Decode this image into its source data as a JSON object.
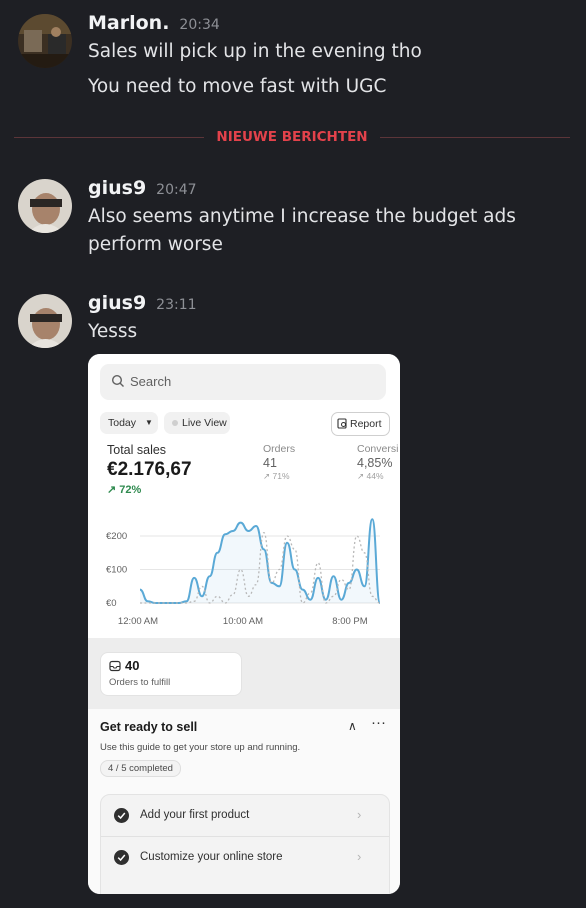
{
  "messages": [
    {
      "author": "Marlon.",
      "time": "20:34",
      "lines": [
        "Sales will pick up in the evening tho",
        "You need to move fast with UGC"
      ]
    },
    {
      "author": "gius9",
      "time": "20:47",
      "lines": [
        "Also seems anytime I increase the budget ads",
        "perform worse"
      ]
    },
    {
      "author": "gius9",
      "time": "23:11",
      "lines": [
        "Yesss"
      ]
    }
  ],
  "divider_label": "NIEUWE BERICHTEN",
  "shopify": {
    "search_placeholder": "Search",
    "filter_today": "Today",
    "live_view": "Live View",
    "report": "Report",
    "total_sales_label": "Total sales",
    "total_sales_value": "€2.176,67",
    "total_sales_delta": "↗ 72%",
    "orders_label": "Orders",
    "orders_value": "41",
    "orders_delta": "↗ 71%",
    "conversion_label": "Conversi",
    "conversion_value": "4,85%",
    "conversion_delta": "↗ 44%",
    "orders_to_fulfill_count": "40",
    "orders_to_fulfill_label": "Orders to fulfill",
    "guide_title": "Get ready to sell",
    "guide_sub": "Use this guide to get your store up and running.",
    "guide_progress": "4 / 5 completed",
    "steps": [
      "Add your first product",
      "Customize your online store"
    ]
  },
  "chart_data": {
    "type": "line",
    "x_ticks": [
      "12:00 AM",
      "10:00 AM",
      "8:00 PM"
    ],
    "y_ticks": [
      "€200",
      "€100",
      "€0"
    ],
    "ylim": [
      0,
      250
    ],
    "series": [
      {
        "style": "solid",
        "color": "#5aa9d6",
        "values": [
          40,
          5,
          0,
          0,
          0,
          0,
          5,
          75,
          20,
          80,
          150,
          205,
          215,
          240,
          215,
          230,
          160,
          60,
          50,
          180,
          100,
          40,
          10,
          75,
          10,
          80,
          10,
          60,
          100,
          50,
          280,
          0
        ]
      },
      {
        "style": "dotted",
        "color": "#b8b8b8",
        "values": [
          0,
          0,
          0,
          0,
          0,
          0,
          0,
          5,
          50,
          0,
          20,
          0,
          25,
          100,
          20,
          55,
          210,
          60,
          100,
          200,
          160,
          0,
          30,
          120,
          0,
          20,
          70,
          40,
          200,
          150,
          20,
          0
        ]
      }
    ]
  },
  "colors": {
    "background": "#1e1f24",
    "accent_new": "#e3424b",
    "chart_line": "#5aa9d6",
    "positive": "#2f8a4f"
  }
}
